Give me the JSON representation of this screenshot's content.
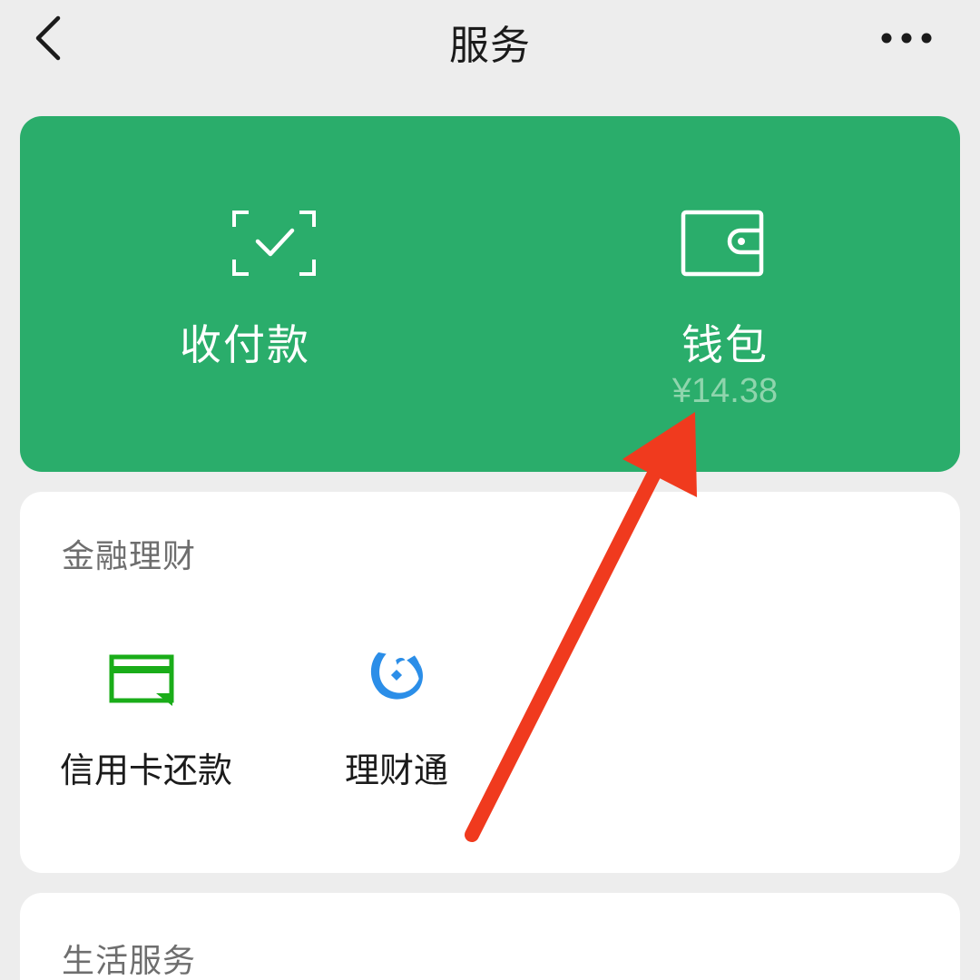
{
  "header": {
    "title": "服务",
    "back_icon": "chevron-left-icon",
    "more_icon": "more-horizontal-icon"
  },
  "top_card": {
    "background": "#2aad6b",
    "pay": {
      "label": "收付款",
      "icon": "scan-check-icon"
    },
    "wallet": {
      "label": "钱包",
      "balance": "¥14.38",
      "icon": "wallet-icon"
    }
  },
  "finance": {
    "title": "金融理财",
    "items": [
      {
        "label": "信用卡还款",
        "icon": "credit-card-icon",
        "color": "#1aad19"
      },
      {
        "label": "理财通",
        "icon": "licaitong-icon",
        "color": "#2b8ee8"
      }
    ]
  },
  "life": {
    "title": "生活服务"
  },
  "annotation": {
    "arrow_color": "#f03a1e"
  }
}
